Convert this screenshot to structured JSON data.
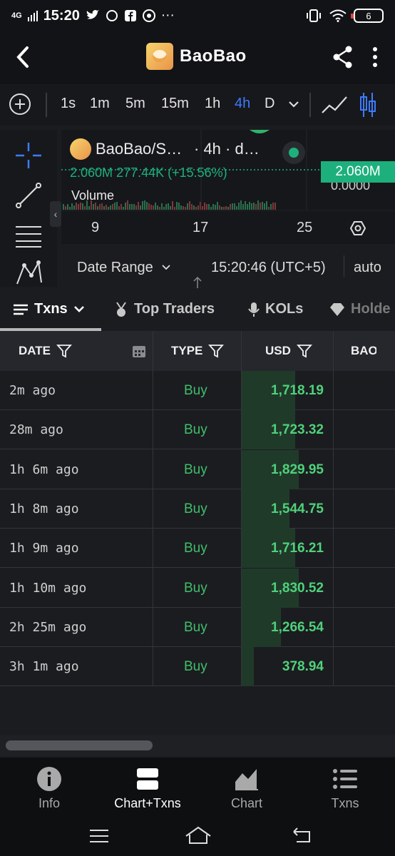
{
  "status_bar": {
    "network": "4G",
    "time": "15:20",
    "battery": "6"
  },
  "header": {
    "title": "BaoBao"
  },
  "timeframes": [
    {
      "label": "1s"
    },
    {
      "label": "1m"
    },
    {
      "label": "5m"
    },
    {
      "label": "15m"
    },
    {
      "label": "1h"
    },
    {
      "label": "4h",
      "active": true
    },
    {
      "label": "D"
    }
  ],
  "chart": {
    "symbol": "BaoBao/S…",
    "interval": "· 4h · d…",
    "volume_line": "2.060M  277.44K (+15.56%)",
    "volume_label": "Volume",
    "price_tag": "2.060M",
    "axis_value": "0.0000",
    "x_ticks": [
      "9",
      "17",
      "25"
    ],
    "date_range_label": "Date Range",
    "clock": "15:20:46 (UTC+5)",
    "scale_mode": "auto"
  },
  "tabs": [
    {
      "label": "Txns",
      "active": true
    },
    {
      "label": "Top Traders"
    },
    {
      "label": "KOLs"
    },
    {
      "label": "Holde"
    }
  ],
  "table": {
    "columns": [
      "DATE",
      "TYPE",
      "USD",
      "BAO"
    ],
    "rows": [
      {
        "date": "2m ago",
        "type": "Buy",
        "usd": "1,718.19",
        "fill": 0.94
      },
      {
        "date": "28m ago",
        "type": "Buy",
        "usd": "1,723.32",
        "fill": 0.94
      },
      {
        "date": "1h 6m ago",
        "type": "Buy",
        "usd": "1,829.95",
        "fill": 1.0
      },
      {
        "date": "1h 8m ago",
        "type": "Buy",
        "usd": "1,544.75",
        "fill": 0.84
      },
      {
        "date": "1h 9m ago",
        "type": "Buy",
        "usd": "1,716.21",
        "fill": 0.94
      },
      {
        "date": "1h 10m ago",
        "type": "Buy",
        "usd": "1,830.52",
        "fill": 1.0
      },
      {
        "date": "2h 25m ago",
        "type": "Buy",
        "usd": "1,266.54",
        "fill": 0.69
      },
      {
        "date": "3h 1m ago",
        "type": "Buy",
        "usd": "378.94",
        "fill": 0.21
      }
    ]
  },
  "bottom_nav": [
    {
      "label": "Info",
      "icon": "info-icon"
    },
    {
      "label": "Chart+Txns",
      "icon": "chart-txns-icon",
      "active": true
    },
    {
      "label": "Chart",
      "icon": "area-chart-icon"
    },
    {
      "label": "Txns",
      "icon": "list-icon"
    }
  ],
  "colors": {
    "buy": "#3fbf6a",
    "accent": "#3d7bff",
    "price_tag": "#1db07c"
  }
}
